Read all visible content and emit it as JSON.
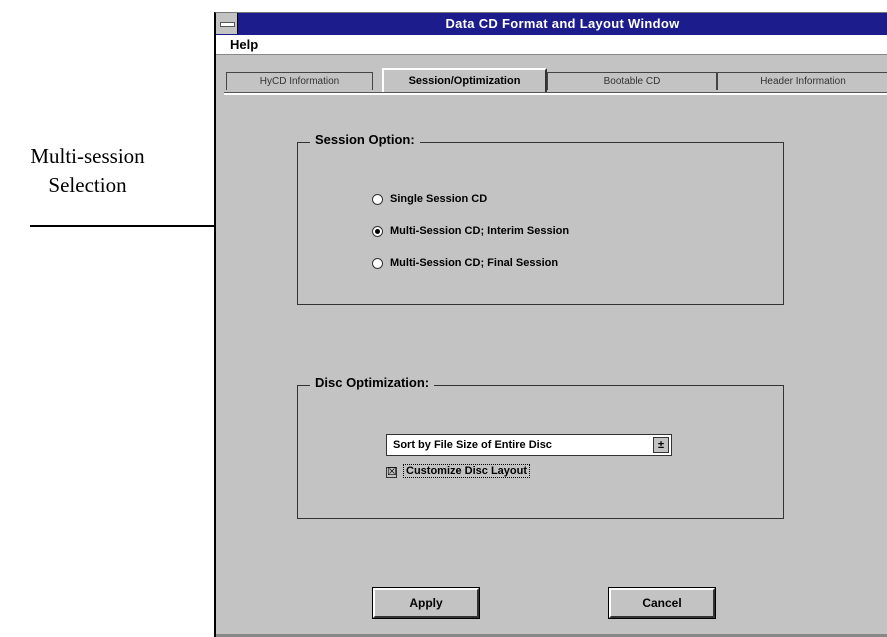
{
  "annotation": {
    "line1": "Multi-session",
    "line2": "Selection"
  },
  "window": {
    "title": "Data CD Format and Layout Window"
  },
  "menu": {
    "help": "Help"
  },
  "tabs": [
    {
      "label": "HyCD Information",
      "active": false
    },
    {
      "label": "Session/Optimization",
      "active": true
    },
    {
      "label": "Bootable CD",
      "active": false
    },
    {
      "label": "Header Information",
      "active": false
    }
  ],
  "session_group": {
    "title": "Session Option:",
    "options": [
      {
        "label": "Single Session CD",
        "selected": false
      },
      {
        "label": "Multi-Session CD; Interim Session",
        "selected": true
      },
      {
        "label": "Multi-Session CD; Final Session",
        "selected": false
      }
    ]
  },
  "disc_group": {
    "title": "Disc Optimization:",
    "sort_select": {
      "value": "Sort by File Size of Entire Disc"
    },
    "customize": {
      "label": "Customize Disc Layout",
      "checked": true,
      "mark": "☒"
    }
  },
  "buttons": {
    "apply": "Apply",
    "cancel": "Cancel"
  },
  "colors": {
    "titlebar": "#1c1c8c",
    "window_bg": "#c3c3c3"
  }
}
